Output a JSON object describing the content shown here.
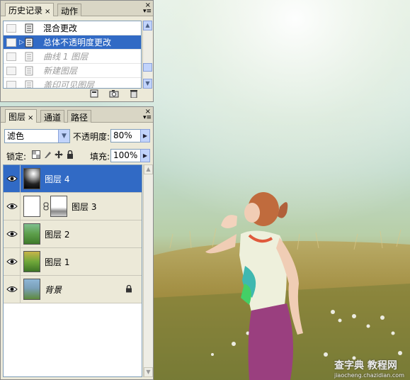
{
  "history_panel": {
    "tabs": [
      {
        "label": "历史记录",
        "close": "×"
      },
      {
        "label": "动作"
      }
    ],
    "close": "×",
    "menu": "▾≡",
    "items": [
      {
        "label": "混合更改",
        "state": "normal"
      },
      {
        "label": "总体不透明度更改",
        "state": "selected"
      },
      {
        "label": "曲线 1 图层",
        "state": "disabled"
      },
      {
        "label": "新建图层",
        "state": "disabled"
      },
      {
        "label": "盖印可见图层",
        "state": "disabled"
      }
    ],
    "footer_icons": [
      "new-document-icon",
      "snapshot-camera-icon",
      "trash-icon"
    ]
  },
  "layers_panel": {
    "tabs": [
      {
        "label": "图层",
        "close": "×"
      },
      {
        "label": "通道"
      },
      {
        "label": "路径"
      }
    ],
    "close": "×",
    "menu": "▾≡",
    "blend_mode": "滤色",
    "opacity_label": "不透明度:",
    "opacity_value": "80%",
    "lock_label": "锁定:",
    "lock_icons": [
      "lock-transparent-icon",
      "lock-paint-icon",
      "lock-move-icon",
      "lock-all-icon"
    ],
    "fill_label": "填充:",
    "fill_value": "100%",
    "layers": [
      {
        "name": "图层 4",
        "selected": true,
        "visible": true
      },
      {
        "name": "图层 3",
        "selected": false,
        "visible": true,
        "mask": true
      },
      {
        "name": "图层 2",
        "selected": false,
        "visible": true
      },
      {
        "name": "图层 1",
        "selected": false,
        "visible": true
      },
      {
        "name": "背景",
        "selected": false,
        "visible": true,
        "locked": true,
        "italic": true
      }
    ]
  },
  "watermark": {
    "text": "查字典 教程网",
    "url": "jiaocheng.chazidian.com"
  },
  "colors": {
    "selection": "#316ac5",
    "panel_bg": "#ece9d8"
  }
}
